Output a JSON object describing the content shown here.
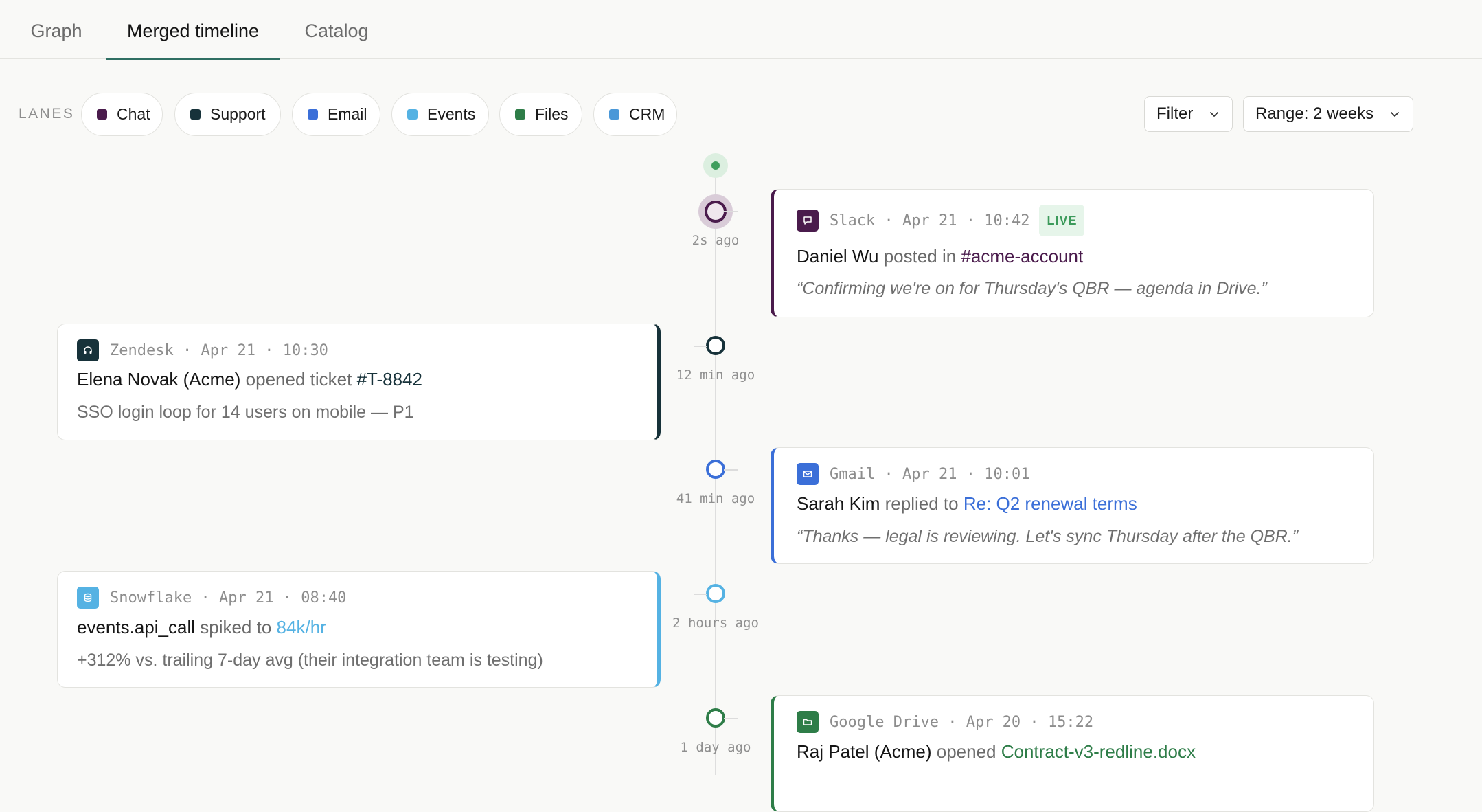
{
  "tabs": [
    {
      "label": "Graph"
    },
    {
      "label": "Merged timeline"
    },
    {
      "label": "Catalog"
    }
  ],
  "active_tab": "Merged timeline",
  "lanes": {
    "label": "LANES",
    "chips": [
      {
        "label": "Chat",
        "color": "#4a1b4c"
      },
      {
        "label": "Support",
        "color": "#17323a"
      },
      {
        "label": "Email",
        "color": "#3b6fd8"
      },
      {
        "label": "Events",
        "color": "#55b2e3"
      },
      {
        "label": "Files",
        "color": "#2e7d48"
      },
      {
        "label": "CRM",
        "color": "#4a98d8"
      }
    ]
  },
  "controls": {
    "filter_label": "Filter",
    "range_label": "Range: 2 weeks"
  },
  "events": [
    {
      "source": "Slack",
      "date": "Apr 21",
      "time": "10:42",
      "relative": "2s ago",
      "live_badge": "LIVE",
      "icon": "chat-bubble-icon",
      "color": "#4a1b4c",
      "actor": "Daniel Wu",
      "verb": "posted in",
      "target": "#acme-account",
      "detail": "“Confirming we're on for Thursday's QBR — agenda in Drive.”"
    },
    {
      "source": "Zendesk",
      "date": "Apr 21",
      "time": "10:30",
      "relative": "12 min ago",
      "icon": "headset-icon",
      "color": "#17323a",
      "actor": "Elena Novak (Acme)",
      "verb": "opened ticket",
      "target": "#T-8842",
      "detail": "SSO login loop for 14 users on mobile — P1"
    },
    {
      "source": "Gmail",
      "date": "Apr 21",
      "time": "10:01",
      "relative": "41 min ago",
      "icon": "mail-icon",
      "color": "#3b6fd8",
      "actor": "Sarah Kim",
      "verb": "replied to",
      "target": "Re: Q2 renewal terms",
      "detail": "“Thanks — legal is reviewing. Let's sync Thursday after the QBR.”"
    },
    {
      "source": "Snowflake",
      "date": "Apr 21",
      "time": "08:40",
      "relative": "2 hours ago",
      "icon": "database-icon",
      "color": "#55b2e3",
      "actor": "events.api_call",
      "verb": "spiked to",
      "target": "84k/hr",
      "detail": "+312% vs. trailing 7-day avg (their integration team is testing)"
    },
    {
      "source": "Google Drive",
      "date": "Apr 20",
      "time": "15:22",
      "relative": "1 day ago",
      "icon": "folder-icon",
      "color": "#2e7d48",
      "actor": "Raj Patel (Acme)",
      "verb": "opened",
      "target": "Contract-v3-redline.docx"
    }
  ]
}
